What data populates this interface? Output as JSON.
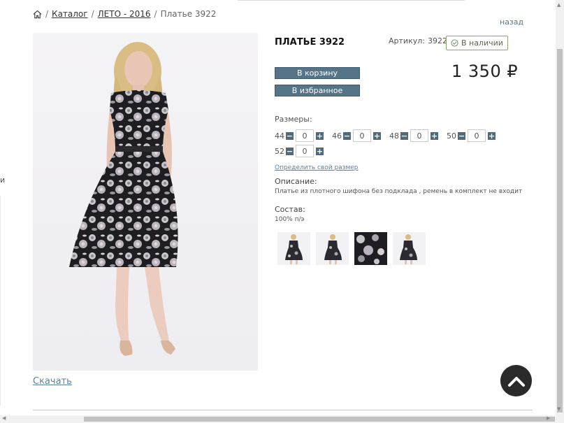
{
  "breadcrumb": {
    "home_icon": "home-icon",
    "items": [
      "Каталог",
      "ЛЕТО - 2016",
      "Платье 3922"
    ],
    "separator": "/"
  },
  "back_label": "назад",
  "left_edge_char": "и",
  "product": {
    "title": "ПЛАТЬЕ 3922",
    "sku_label": "Артикул:",
    "sku_value": "3922",
    "stock_label": "В наличии",
    "price": "1 350 ₽"
  },
  "buttons": {
    "cart": "В корзину",
    "favorites": "В избранное"
  },
  "sizes": {
    "label": "Размеры:",
    "items": [
      {
        "size": "44",
        "qty": "0"
      },
      {
        "size": "46",
        "qty": "0"
      },
      {
        "size": "48",
        "qty": "0"
      },
      {
        "size": "50",
        "qty": "0"
      },
      {
        "size": "52",
        "qty": "0"
      }
    ],
    "minus": "−",
    "plus": "+",
    "help_link": "Определить свой размер"
  },
  "description": {
    "label": "Описание:",
    "text": "Платье из плотного шифона без подклада , ремень в комплект не входит"
  },
  "composition": {
    "label": "Состав:",
    "text": "100% п/э"
  },
  "download_label": "Скачать",
  "colors": {
    "button": "#557488",
    "stock_border": "#8aa86c",
    "link": "#5a84a3"
  }
}
